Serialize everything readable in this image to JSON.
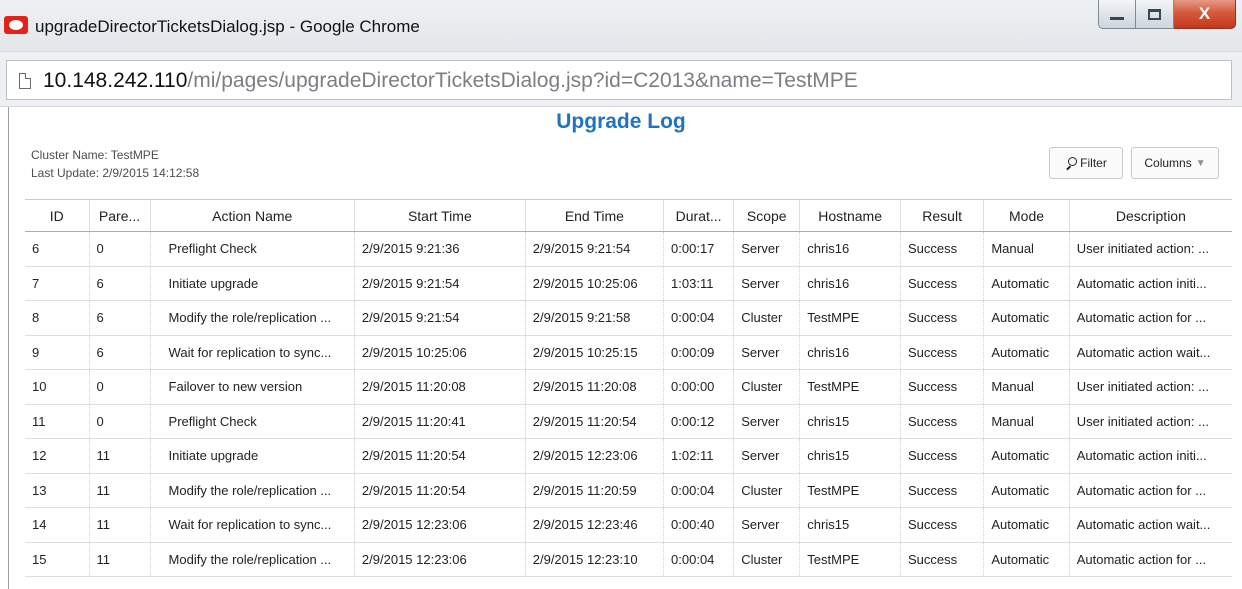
{
  "window": {
    "title": "upgradeDirectorTicketsDialog.jsp - Google Chrome",
    "controls": {
      "minimize": "minimize",
      "maximize": "maximize",
      "close": "X"
    }
  },
  "address_bar": {
    "host": "10.148.242.110",
    "path": "/mi/pages/upgradeDirectorTicketsDialog.jsp?id=C2013&name=TestMPE"
  },
  "page": {
    "title": "Upgrade Log",
    "cluster_name": "Cluster Name: TestMPE",
    "last_update": "Last Update: 2/9/2015 14:12:58",
    "filter_label": "Filter",
    "columns_label": "Columns"
  },
  "colors": {
    "title": "#1f73c2",
    "close_button": "#c4381b",
    "app_icon": "#e0241b"
  },
  "icons": [
    "app-icon",
    "page-icon",
    "filter-search-icon",
    "chevron-down-icon",
    "minimize-icon",
    "maximize-icon",
    "close-icon"
  ],
  "table": {
    "columns": [
      "ID",
      "Pare...",
      "Action Name",
      "Start Time",
      "End Time",
      "Durat...",
      "Scope",
      "Hostname",
      "Result",
      "Mode",
      "Description"
    ],
    "rows": [
      [
        "6",
        "0",
        "Preflight Check",
        "2/9/2015 9:21:36",
        "2/9/2015 9:21:54",
        "0:00:17",
        "Server",
        "chris16",
        "Success",
        "Manual",
        "User initiated action: ..."
      ],
      [
        "7",
        "6",
        "Initiate upgrade",
        "2/9/2015 9:21:54",
        "2/9/2015 10:25:06",
        "1:03:11",
        "Server",
        "chris16",
        "Success",
        "Automatic",
        "Automatic action initi..."
      ],
      [
        "8",
        "6",
        "Modify the role/replication ...",
        "2/9/2015 9:21:54",
        "2/9/2015 9:21:58",
        "0:00:04",
        "Cluster",
        "TestMPE",
        "Success",
        "Automatic",
        "Automatic action for ..."
      ],
      [
        "9",
        "6",
        "Wait for replication to sync...",
        "2/9/2015 10:25:06",
        "2/9/2015 10:25:15",
        "0:00:09",
        "Server",
        "chris16",
        "Success",
        "Automatic",
        "Automatic action wait..."
      ],
      [
        "10",
        "0",
        "Failover to new version",
        "2/9/2015 11:20:08",
        "2/9/2015 11:20:08",
        "0:00:00",
        "Cluster",
        "TestMPE",
        "Success",
        "Manual",
        "User initiated action: ..."
      ],
      [
        "11",
        "0",
        "Preflight Check",
        "2/9/2015 11:20:41",
        "2/9/2015 11:20:54",
        "0:00:12",
        "Server",
        "chris15",
        "Success",
        "Manual",
        "User initiated action: ..."
      ],
      [
        "12",
        "11",
        "Initiate upgrade",
        "2/9/2015 11:20:54",
        "2/9/2015 12:23:06",
        "1:02:11",
        "Server",
        "chris15",
        "Success",
        "Automatic",
        "Automatic action initi..."
      ],
      [
        "13",
        "11",
        "Modify the role/replication ...",
        "2/9/2015 11:20:54",
        "2/9/2015 11:20:59",
        "0:00:04",
        "Cluster",
        "TestMPE",
        "Success",
        "Automatic",
        "Automatic action for ..."
      ],
      [
        "14",
        "11",
        "Wait for replication to sync...",
        "2/9/2015 12:23:06",
        "2/9/2015 12:23:46",
        "0:00:40",
        "Server",
        "chris15",
        "Success",
        "Automatic",
        "Automatic action wait..."
      ],
      [
        "15",
        "11",
        "Modify the role/replication ...",
        "2/9/2015 12:23:06",
        "2/9/2015 12:23:10",
        "0:00:04",
        "Cluster",
        "TestMPE",
        "Success",
        "Automatic",
        "Automatic action for ..."
      ]
    ]
  }
}
